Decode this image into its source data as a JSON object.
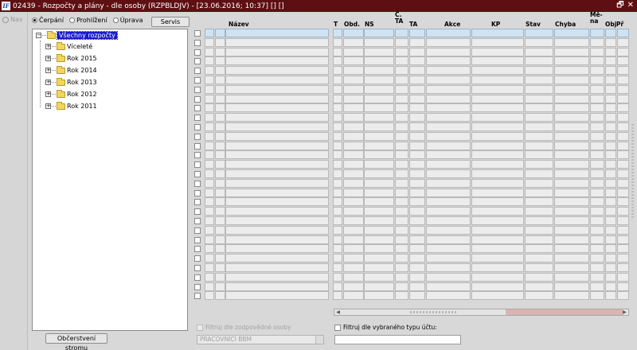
{
  "window": {
    "app_icon_text": "IF",
    "title": "02439 - Rozpočty a plány - dle osoby (RZPBLDJV) - [23.06.2016; 10:37] [] []",
    "restore_glyph": "🗗",
    "close_glyph": "✕"
  },
  "nav": {
    "label": "Nav"
  },
  "mode": {
    "options": [
      {
        "label": "Čerpání",
        "selected": true
      },
      {
        "label": "Prohlížení",
        "selected": false
      },
      {
        "label": "Úprava",
        "selected": false
      }
    ],
    "servis_label": "Servis"
  },
  "tree": {
    "root": {
      "label": "Všechny rozpočty",
      "expander": "−"
    },
    "children": [
      {
        "label": "Víceleté",
        "expander": "+"
      },
      {
        "label": "Rok 2015",
        "expander": "+"
      },
      {
        "label": "Rok 2014",
        "expander": "+"
      },
      {
        "label": "Rok 2013",
        "expander": "+"
      },
      {
        "label": "Rok 2012",
        "expander": "+"
      },
      {
        "label": "Rok 2011",
        "expander": "+"
      }
    ]
  },
  "refresh_button": "Občerstvení stromu",
  "grid": {
    "columns": {
      "nazev": "Název",
      "t": "T",
      "obd": "Obd.",
      "ns": "NS",
      "c_ta": "Č.\nTA",
      "ta": "TA",
      "akce": "Akce",
      "kp": "KP",
      "stav": "Stav",
      "chyba": "Chyba",
      "mena": "Mě-\nna",
      "obj": "Obj",
      "pr": "Př"
    }
  },
  "filters": {
    "responsible_label": "Filtruj dle zodpovědné osoby",
    "responsible_value": "PRACOVNÍCI BBM",
    "account_type_label": "Filtruj dle vybraného typu účtu:",
    "account_type_value": ""
  }
}
